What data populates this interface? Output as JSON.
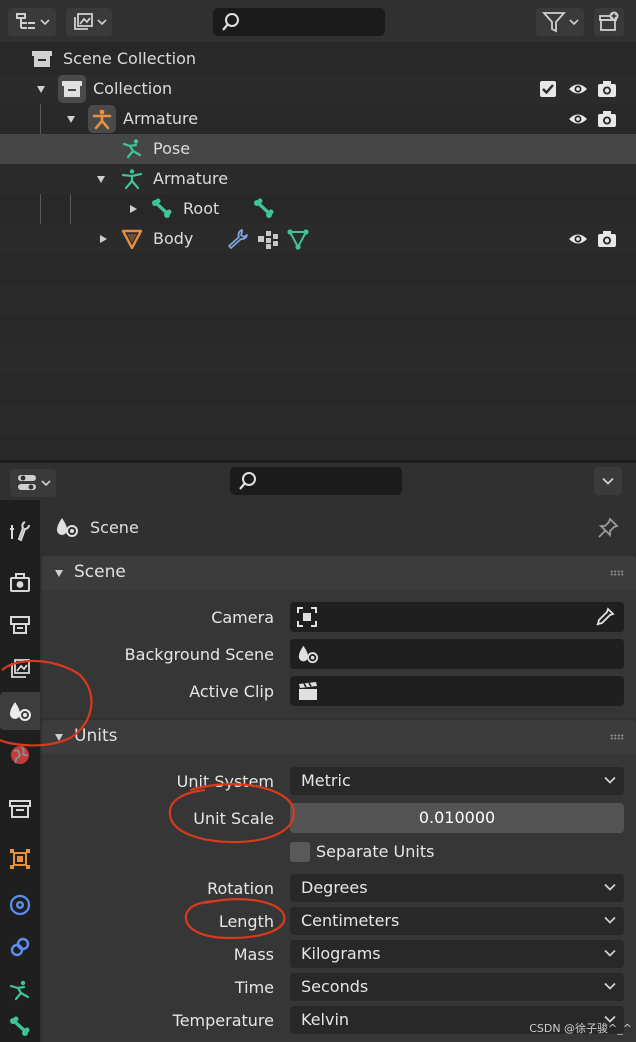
{
  "outliner": {
    "rows": {
      "scene_collection": "Scene Collection",
      "collection": "Collection",
      "armature_obj": "Armature",
      "pose": "Pose",
      "armature_data": "Armature",
      "root": "Root",
      "body": "Body"
    }
  },
  "properties": {
    "context_title": "Scene",
    "scene_panel": {
      "title": "Scene",
      "camera_label": "Camera",
      "background_scene_label": "Background Scene",
      "active_clip_label": "Active Clip"
    },
    "units_panel": {
      "title": "Units",
      "unit_system_label": "Unit System",
      "unit_system_value": "Metric",
      "unit_scale_label": "Unit Scale",
      "unit_scale_value": "0.010000",
      "separate_units_label": "Separate Units",
      "separate_units_checked": false,
      "rotation_label": "Rotation",
      "rotation_value": "Degrees",
      "length_label": "Length",
      "length_value": "Centimeters",
      "mass_label": "Mass",
      "mass_value": "Kilograms",
      "time_label": "Time",
      "time_value": "Seconds",
      "temperature_label": "Temperature",
      "temperature_value": "Kelvin"
    }
  },
  "watermark": "CSDN @徐子骏^_^",
  "colors": {
    "accent_green": "#3fc39a",
    "object_orange": "#e98f3d",
    "wrench_blue": "#7aa6e0",
    "annotation_red": "#d93a1c"
  }
}
